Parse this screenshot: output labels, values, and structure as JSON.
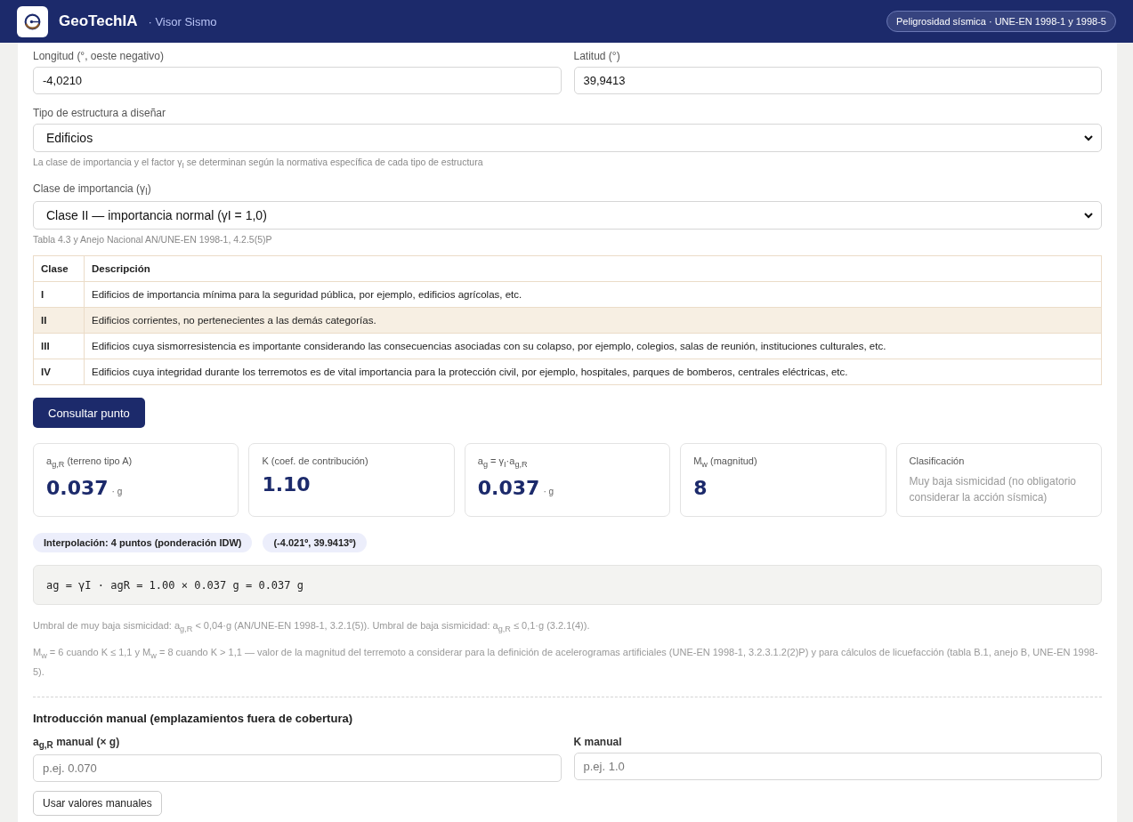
{
  "header": {
    "brand": "GeoTechIA",
    "subtitle": "· Visor Sismo",
    "badge": "Peligrosidad sísmica · UNE-EN 1998-1 y 1998-5"
  },
  "coordinates": [
    {
      "label": "Longitud (°, oeste negativo)",
      "value": "-4,0210"
    },
    {
      "label": "Latitud (°)",
      "value": "39,9413"
    }
  ],
  "structure_type": {
    "label": "Tipo de estructura a diseñar",
    "value": "Edificios",
    "hint": "La clase de importancia y el factor γ$_{I}$ se determinan según la normativa específica de cada tipo de estructura"
  },
  "importance_class": {
    "label": "Clase de importancia (γ$_{I}$)",
    "value": "Clase II — importancia normal (γI = 1,0)",
    "hint": "Tabla 4.3 y Anejo Nacional AN/UNE-EN 1998-1, 4.2.5(5)P"
  },
  "table": {
    "columns": [
      "Clase",
      "Descripción"
    ],
    "rows": [
      {
        "cells": [
          "I",
          "Edificios de importancia mínima para la seguridad pública, por ejemplo, edificios agrícolas, etc."
        ],
        "selected": false
      },
      {
        "cells": [
          "II",
          "Edificios corrientes, no pertenecientes a las demás categorías."
        ],
        "selected": true
      },
      {
        "cells": [
          "III",
          "Edificios cuya sismorresistencia es importante considerando las consecuencias asociadas con su colapso, por ejemplo, colegios, salas de reunión, instituciones culturales, etc."
        ],
        "selected": false
      },
      {
        "cells": [
          "IV",
          "Edificios cuya integridad durante los terremotos es de vital importancia para la protección civil, por ejemplo, hospitales, parques de bomberos, centrales eléctricas, etc."
        ],
        "selected": false
      }
    ]
  },
  "query_button": "Consultar punto",
  "results": [
    {
      "kind": "metric",
      "label": "a$_{g,R}$ (terreno tipo A)",
      "value": "0.037",
      "unit": "· g"
    },
    {
      "kind": "metric",
      "label": "K (coef. de contribución)",
      "value": "1.10"
    },
    {
      "kind": "metric",
      "label": "a$_{g}$ = γ$_{I}$·a$_{g,R}$",
      "value": "0.037",
      "unit": "· g"
    },
    {
      "kind": "metric",
      "label": "M$_{w}$ (magnitud)",
      "value": "8"
    },
    {
      "kind": "text",
      "label": "Clasificación",
      "text": "Muy baja sismicidad (no obligatorio considerar la acción sísmica)"
    }
  ],
  "chips": [
    "Interpolación: 4 puntos (ponderación IDW)",
    "(-4.021º, 39.9413º)"
  ],
  "formula": "ag = γI · agR = 1.00 × 0.037 g = 0.037 g",
  "notes": [
    "Umbral de muy baja sismicidad: a$_{g,R}$ < 0,04·g (AN/UNE-EN 1998-1, 3.2.1(5)). Umbral de baja sismicidad: a$_{g,R}$ ≤ 0,1·g (3.2.1(4)).",
    "M$_{w}$ = 6 cuando K ≤ 1,1 y M$_{w}$ = 8 cuando K > 1,1 — valor de la magnitud del terremoto a considerar para la definición de acelerogramas artificiales (UNE-EN 1998-1, 3.2.3.1.2(2)P) y para cálculos de licuefacción (tabla B.1, anejo B, UNE-EN 1998-5)."
  ],
  "manual": {
    "title": "Introducción manual (emplazamientos fuera de cobertura)",
    "fields": [
      {
        "label": "a$_{g,R}$ manual (× g)",
        "placeholder": "p.ej. 0.070"
      },
      {
        "label": "K manual",
        "placeholder": "p.ej. 1.0"
      }
    ],
    "button": "Usar valores manuales"
  }
}
